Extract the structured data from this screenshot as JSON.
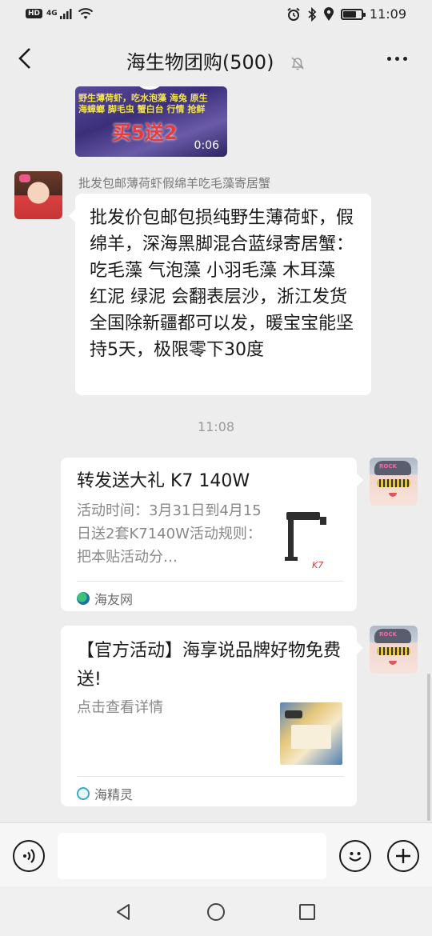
{
  "status_bar": {
    "network_badge": "HD",
    "network_type": "4G",
    "time": "11:09",
    "battery_level": 0.75
  },
  "header": {
    "title": "海生物团购(500)",
    "icons": [
      "back-arrow-icon",
      "mute-bell-icon",
      "more-dots-icon"
    ]
  },
  "messages": {
    "video": {
      "caption_line1": "野生薄荷虾，吃水泡藻 海兔 原生",
      "caption_line2": "海蟑螂 脚毛虫 蟹白台 行情 抢鲜",
      "promo": "买5送2",
      "duration": "0:06"
    },
    "text_message": {
      "sender": "批发包邮薄荷虾假绵羊吃毛藻寄居蟹",
      "content": "批发价包邮包损纯野生薄荷虾，假绵羊，深海黑脚混合蓝绿寄居蟹：吃毛藻 气泡藻 小羽毛藻 木耳藻 红泥 绿泥 会翻表层沙，浙江发货全国除新疆都可以发，暖宝宝能坚持5天，极限零下30度"
    },
    "timestamp": "11:08",
    "card1": {
      "title": "转发送大礼 K7 140W",
      "description": "活动时间：3月31日到4月15日送2套K7140W活动规则：把本贴活动分…",
      "source": "海友网",
      "thumb_label": "K7"
    },
    "card2": {
      "title": "【官方活动】海享说品牌好物免费送!",
      "description": "点击查看详情",
      "source": "海精灵"
    },
    "avatar_cap_text": "ROCK"
  },
  "input_bar": {
    "icons": [
      "voice-icon",
      "emoji-icon",
      "add-icon"
    ],
    "placeholder": ""
  },
  "system_nav": {
    "icons": [
      "nav-back-icon",
      "nav-home-icon",
      "nav-recent-icon"
    ]
  },
  "colors": {
    "background": "#ededed",
    "bubble": "#ffffff",
    "text_primary": "#191919",
    "text_secondary": "#888888",
    "promo_red": "#e83a3a"
  }
}
